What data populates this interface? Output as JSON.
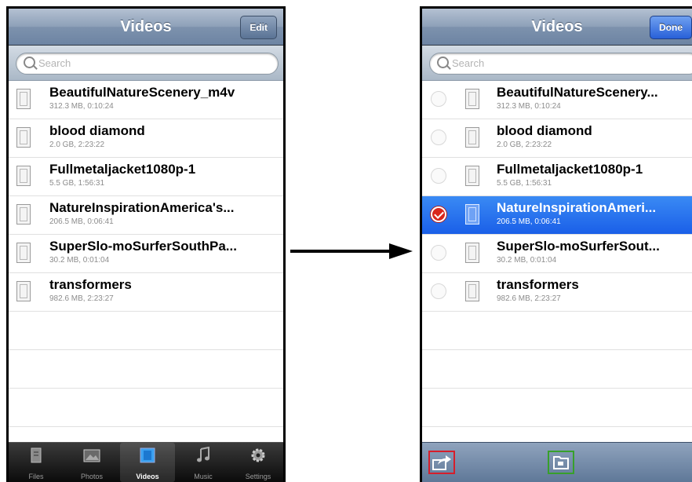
{
  "left_screen": {
    "nav": {
      "title": "Videos",
      "edit_label": "Edit"
    },
    "search": {
      "placeholder": "Search"
    },
    "videos": [
      {
        "title": "BeautifulNatureScenery_m4v",
        "meta": "312.3 MB, 0:10:24"
      },
      {
        "title": "blood diamond",
        "meta": "2.0 GB, 2:23:22"
      },
      {
        "title": "Fullmetaljacket1080p-1",
        "meta": "5.5 GB, 1:56:31"
      },
      {
        "title": "NatureInspirationAmerica's...",
        "meta": "206.5 MB, 0:06:41"
      },
      {
        "title": "SuperSlo-moSurferSouthPa...",
        "meta": "30.2 MB, 0:01:04"
      },
      {
        "title": "transformers",
        "meta": "982.6 MB, 2:23:27"
      }
    ],
    "tabs": [
      {
        "label": "Files",
        "icon": "files-icon"
      },
      {
        "label": "Photos",
        "icon": "photos-icon"
      },
      {
        "label": "Videos",
        "icon": "videos-icon",
        "active": true
      },
      {
        "label": "Music",
        "icon": "music-icon"
      },
      {
        "label": "Settings",
        "icon": "settings-icon"
      }
    ]
  },
  "right_screen": {
    "nav": {
      "title": "Videos",
      "done_label": "Done"
    },
    "search": {
      "placeholder": "Search"
    },
    "videos": [
      {
        "title": "BeautifulNatureScenery...",
        "meta": "312.3 MB, 0:10:24",
        "selected": false
      },
      {
        "title": "blood diamond",
        "meta": "2.0 GB, 2:23:22",
        "selected": false
      },
      {
        "title": "Fullmetaljacket1080p-1",
        "meta": "5.5 GB, 1:56:31",
        "selected": false
      },
      {
        "title": "NatureInspirationAmeri...",
        "meta": "206.5 MB, 0:06:41",
        "selected": true
      },
      {
        "title": "SuperSlo-moSurferSout...",
        "meta": "30.2 MB, 0:01:04",
        "selected": false
      },
      {
        "title": "transformers",
        "meta": "982.6 MB, 2:23:27",
        "selected": false
      }
    ],
    "toolbar": [
      {
        "icon": "share-icon",
        "highlight": "#d61e2b"
      },
      {
        "icon": "folder-icon",
        "highlight": "#37a02b"
      }
    ]
  },
  "colors": {
    "nav_blue": "#7d92ad",
    "selection_blue": "#1a5fe8",
    "done_blue": "#2860d8"
  }
}
